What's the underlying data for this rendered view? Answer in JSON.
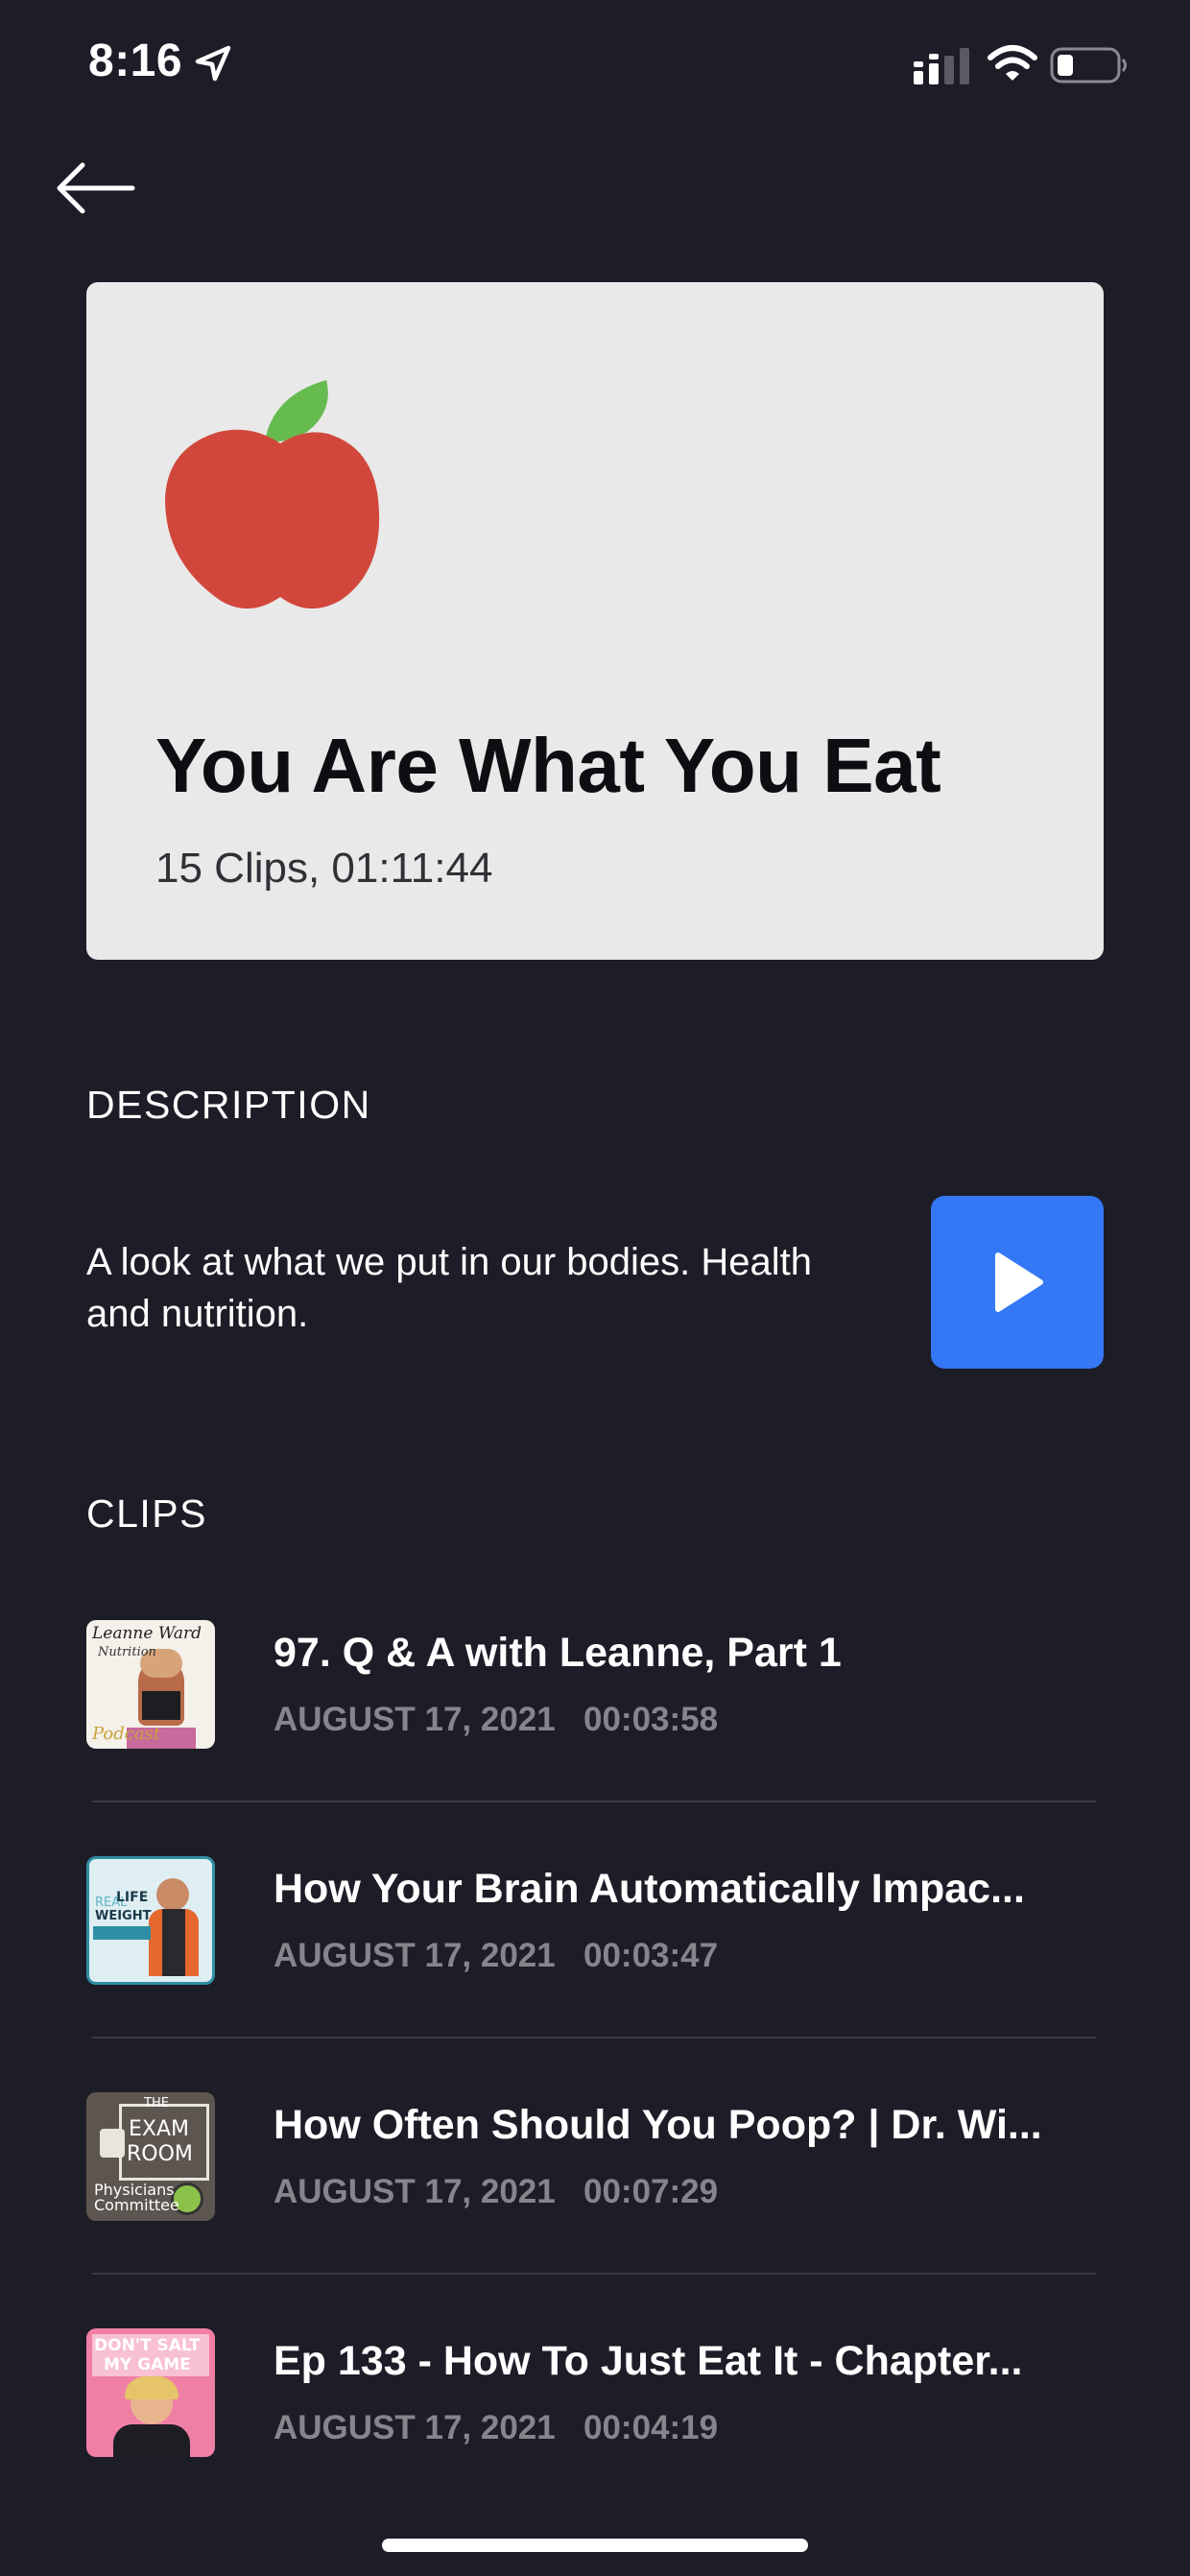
{
  "status_bar": {
    "time": "8:16"
  },
  "playlist": {
    "title": "You Are What You Eat",
    "meta": "15 Clips, 01:11:44",
    "icon": "apple-icon"
  },
  "description": {
    "heading": "DESCRIPTION",
    "text": "A look at what we put in our bodies. Health and nutrition."
  },
  "clips": {
    "heading": "CLIPS",
    "items": [
      {
        "title": "97. Q & A with Leanne, Part 1",
        "date": "AUGUST 17, 2021",
        "duration": "00:03:58",
        "thumb_text_1": "Leanne Ward",
        "thumb_text_2": "Nutrition",
        "thumb_text_3": "Podcast"
      },
      {
        "title": "How Your Brain Automatically Impac...",
        "date": "AUGUST 17, 2021",
        "duration": "00:03:47",
        "thumb_text_1": "REAL",
        "thumb_text_2": "LIFE",
        "thumb_text_3": "WEIGHT"
      },
      {
        "title": "How Often Should You Poop? | Dr. Wi...",
        "date": "AUGUST 17, 2021",
        "duration": "00:07:29",
        "thumb_text_1": "THE",
        "thumb_text_2": "EXAM",
        "thumb_text_3": "ROOM",
        "thumb_text_4": "Physicians",
        "thumb_text_5": "Committee"
      },
      {
        "title": "Ep 133 - How To Just Eat It - Chapter...",
        "date": "AUGUST 17, 2021",
        "duration": "00:04:19",
        "thumb_text_1": "DON'T SALT",
        "thumb_text_2": "MY GAME"
      }
    ]
  },
  "colors": {
    "background": "#1d1d28",
    "card": "#e9e9e9",
    "accent": "#3578f6",
    "muted_text": "#85858c",
    "apple_red": "#d1473b",
    "leaf_green": "#66bb4f"
  }
}
